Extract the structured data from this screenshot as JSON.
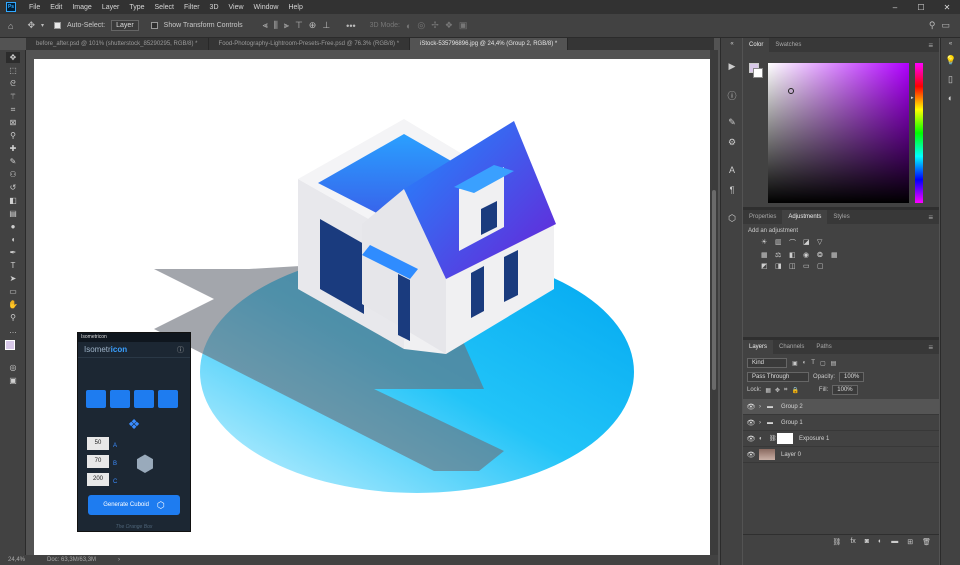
{
  "menu": {
    "logo": "Ps",
    "items": [
      "File",
      "Edit",
      "Image",
      "Layer",
      "Type",
      "Select",
      "Filter",
      "3D",
      "View",
      "Window",
      "Help"
    ],
    "window_controls": [
      "–",
      "☐",
      "✕"
    ]
  },
  "options": {
    "auto_select_label": "Auto-Select:",
    "auto_select_value": "Layer",
    "show_transform_label": "Show Transform Controls",
    "mode_3d": "3D Mode:"
  },
  "tabs": [
    {
      "label": "before_after.psd @ 101% (shutterstock_85290295, RGB/8) *"
    },
    {
      "label": "Food-Photography-Lightroom-Presets-Free.psd @ 76.3% (RGB/8) *"
    },
    {
      "label": "iStock-535796896.jpg @ 24,4% (Group 2, RGB/8) *"
    }
  ],
  "status": {
    "zoom": "24,4%",
    "doc": "Doc: 63,3M/63,3M"
  },
  "color_panel": {
    "tabs": [
      "Color",
      "Swatches"
    ]
  },
  "adjust_panel": {
    "tabs": [
      "Properties",
      "Adjustments",
      "Styles"
    ],
    "title": "Add an adjustment"
  },
  "layers_panel": {
    "tabs": [
      "Layers",
      "Channels",
      "Paths"
    ],
    "kind": "Kind",
    "blend": "Pass Through",
    "opacity_label": "Opacity:",
    "opacity": "100%",
    "lock_label": "Lock:",
    "fill_label": "Fill:",
    "fill": "100%",
    "layers": [
      {
        "name": "Group 2"
      },
      {
        "name": "Group 1"
      },
      {
        "name": "Exposure 1"
      },
      {
        "name": "Layer 0"
      }
    ]
  },
  "plugin": {
    "tab": "Isometricon",
    "title_a": "Isometr",
    "title_b": "icon",
    "values": [
      "50",
      "70",
      "200"
    ],
    "axis_labels": [
      "A",
      "B",
      "C"
    ],
    "button": "Generate Cuboid",
    "brand": "The Orange Box"
  },
  "colors": {
    "accent": "#31a8ff",
    "panel": "#424242",
    "plugin_bg": "#1c2733",
    "plugin_button": "#1e7cf0",
    "house_blue": "#1a6cf0",
    "house_purple": "#6a28d8",
    "shadow_blue": "#00b8f5"
  }
}
